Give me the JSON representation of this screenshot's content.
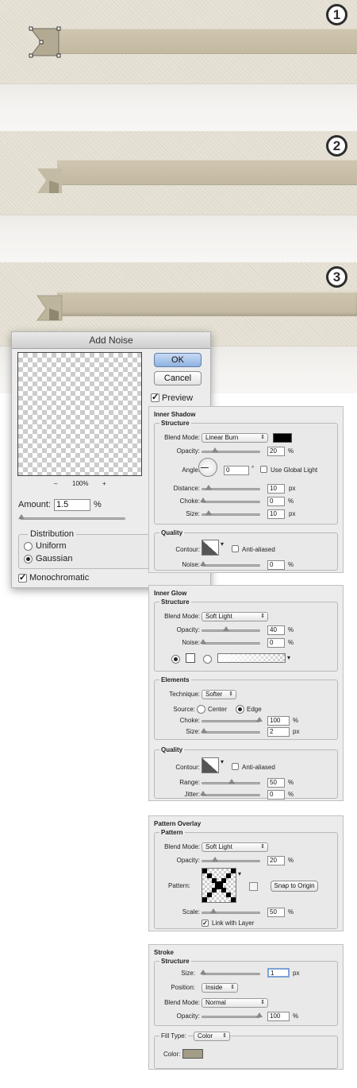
{
  "stages": [
    {
      "number": "1"
    },
    {
      "number": "2"
    },
    {
      "number": "3"
    }
  ],
  "add_noise": {
    "title": "Add Noise",
    "ok": "OK",
    "cancel": "Cancel",
    "preview_label": "Preview",
    "preview_checked": "✓",
    "zoom_minus": "–",
    "zoom": "100%",
    "zoom_plus": "+",
    "amount_label": "Amount:",
    "amount_value": "1.5",
    "amount_unit": "%",
    "distribution_label": "Distribution",
    "uniform": "Uniform",
    "gaussian": "Gaussian",
    "monochromatic": "Monochromatic",
    "monochromatic_checked": "✓",
    "selected_distribution": "Gaussian"
  },
  "inner_shadow": {
    "title": "Inner Shadow",
    "structure": "Structure",
    "blend_mode_label": "Blend Mode:",
    "blend_mode": "Linear Burn",
    "color": "#000000",
    "opacity_label": "Opacity:",
    "opacity": "20",
    "pct": "%",
    "angle_label": "Angle:",
    "angle": "0",
    "degree": "°",
    "global_light": "Use Global Light",
    "distance_label": "Distance:",
    "distance": "10",
    "px": "px",
    "choke_label": "Choke:",
    "choke": "0",
    "size_label": "Size:",
    "size": "10",
    "quality": "Quality",
    "contour_label": "Contour:",
    "anti_aliased": "Anti-aliased",
    "noise_label": "Noise:",
    "noise": "0"
  },
  "inner_glow": {
    "title": "Inner Glow",
    "structure": "Structure",
    "blend_mode_label": "Blend Mode:",
    "blend_mode": "Soft Light",
    "opacity_label": "Opacity:",
    "opacity": "40",
    "pct": "%",
    "noise_label": "Noise:",
    "noise": "0",
    "elements": "Elements",
    "technique_label": "Technique:",
    "technique": "Softer",
    "source_label": "Source:",
    "center": "Center",
    "edge": "Edge",
    "choke_label": "Choke:",
    "choke": "100",
    "size_label": "Size:",
    "size": "2",
    "px": "px",
    "quality": "Quality",
    "contour_label": "Contour:",
    "anti_aliased": "Anti-aliased",
    "range_label": "Range:",
    "range": "50",
    "jitter_label": "Jitter:",
    "jitter": "0"
  },
  "pattern_overlay": {
    "title": "Pattern Overlay",
    "pattern_group": "Pattern",
    "blend_mode_label": "Blend Mode:",
    "blend_mode": "Soft Light",
    "opacity_label": "Opacity:",
    "opacity": "20",
    "pct": "%",
    "pattern_label": "Pattern:",
    "snap": "Snap to Origin",
    "scale_label": "Scale:",
    "scale": "50",
    "link": "Link with Layer",
    "link_checked": "✓"
  },
  "stroke": {
    "title": "Stroke",
    "structure": "Structure",
    "size_label": "Size:",
    "size": "1",
    "px": "px",
    "position_label": "Position:",
    "position": "Inside",
    "blend_mode_label": "Blend Mode:",
    "blend_mode": "Normal",
    "opacity_label": "Opacity:",
    "opacity": "100",
    "pct": "%",
    "fill_type_label": "Fill Type:",
    "fill_type": "Color",
    "color_label": "Color:",
    "color": "#a39d86"
  },
  "colors": {
    "linen": "#e8e3d6",
    "ribbon": "#c9c0a9",
    "ribbon_fold": "#b7ae97"
  }
}
